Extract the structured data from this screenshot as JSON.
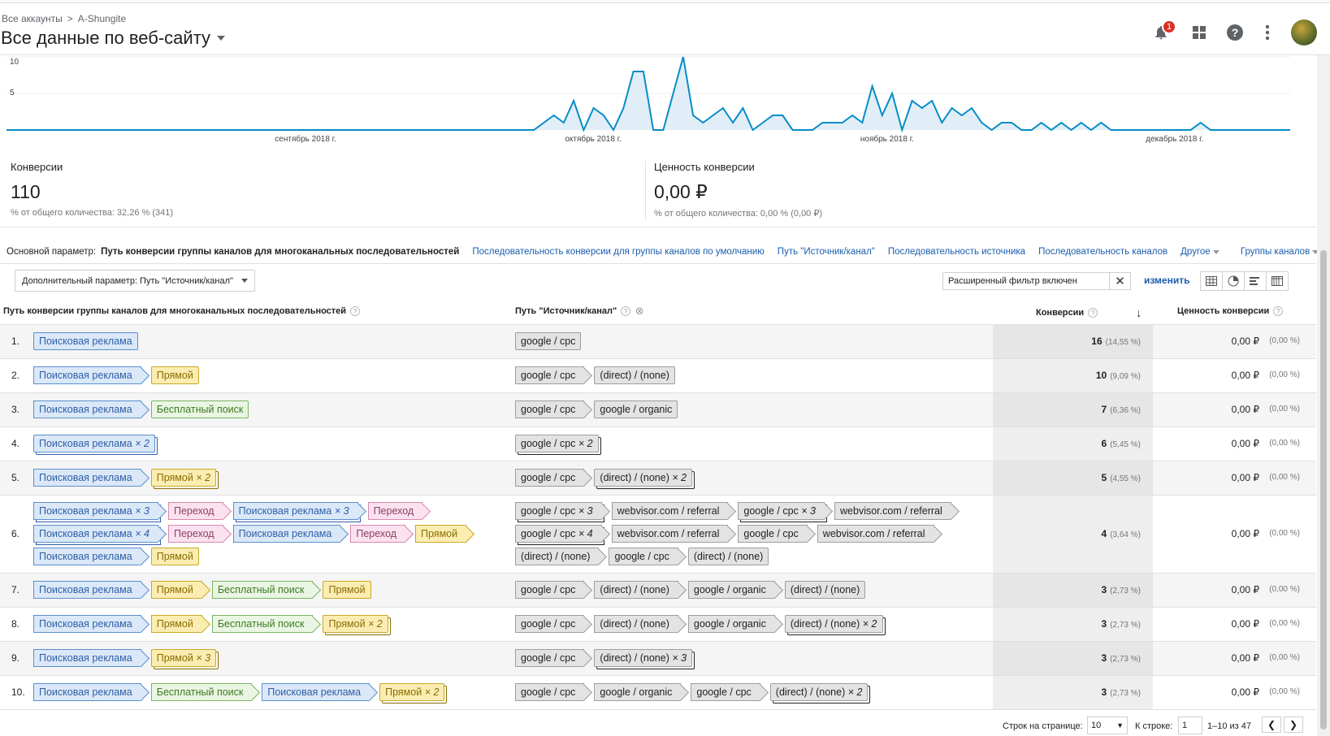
{
  "header": {
    "breadcrumb": [
      "Все аккаунты",
      ">",
      "A-Shungite"
    ],
    "view_title": "Все данные по веб-сайту",
    "notification_count": "1"
  },
  "chart_data": {
    "type": "area",
    "y_ticks": [
      "10",
      "5"
    ],
    "ylim": [
      0,
      10
    ],
    "x_labels": [
      "сентябрь 2018 г.",
      "октябрь 2018 г.",
      "ноябрь 2018 г.",
      "декабрь 2018 г."
    ],
    "values": [
      0,
      0,
      0,
      0,
      0,
      0,
      0,
      0,
      0,
      0,
      0,
      0,
      0,
      0,
      0,
      0,
      0,
      0,
      0,
      0,
      0,
      0,
      0,
      0,
      0,
      0,
      0,
      0,
      0,
      0,
      0,
      0,
      0,
      0,
      0,
      0,
      0,
      0,
      0,
      0,
      0,
      0,
      0,
      0,
      0,
      0,
      0,
      0,
      0,
      0,
      0,
      0,
      0,
      0,
      1,
      2,
      1,
      4,
      0,
      3,
      2,
      0,
      3,
      8,
      8,
      0,
      0,
      5,
      10,
      2,
      1,
      2,
      3,
      1,
      3,
      0,
      1,
      2,
      2,
      0,
      0,
      0,
      1,
      1,
      1,
      2,
      1,
      6,
      2,
      5,
      0,
      4,
      3,
      4,
      1,
      3,
      2,
      3,
      1,
      0,
      1,
      1,
      0,
      0,
      1,
      0,
      1,
      0,
      1,
      0,
      1,
      0,
      0,
      0,
      0,
      0,
      0,
      0,
      0,
      0,
      1,
      0,
      0,
      0,
      0,
      0,
      0,
      0,
      0,
      0
    ],
    "colors": {
      "line": "#058dc7",
      "fill": "#e1eef7"
    }
  },
  "metrics": [
    {
      "label": "Конверсии",
      "value": "110",
      "sub": "% от общего количества: 32,26 % (341)"
    },
    {
      "label": "Ценность конверсии",
      "value": "0,00 ₽",
      "sub": "% от общего количества: 0,00 % (0,00 ₽)"
    }
  ],
  "dimensions": {
    "label": "Основной параметр:",
    "active": "Путь конверсии группы каналов для многоканальных последовательностей",
    "links": [
      "Последовательность конверсии для группы каналов по умолчанию",
      "Путь \"Источник/канал\"",
      "Последовательность источника",
      "Последовательность каналов",
      "Другое",
      "Группы каналов"
    ]
  },
  "controls": {
    "secondary_dimension": "Дополнительный параметр: Путь \"Источник/канал\"",
    "filter_text": "Расширенный фильтр включен",
    "change_label": "изменить"
  },
  "table": {
    "headers": {
      "path": "Путь конверсии группы каналов для многоканальных последовательностей",
      "source": "Путь \"Источник/канал\"",
      "conversions": "Конверсии",
      "value": "Ценность конверсии"
    },
    "rows": [
      {
        "n": "1.",
        "conv": "16",
        "pct": "(14,55 %)",
        "val": "0,00 ₽",
        "vpct": "(0,00 %)"
      },
      {
        "n": "2.",
        "conv": "10",
        "pct": "(9,09 %)",
        "val": "0,00 ₽",
        "vpct": "(0,00 %)"
      },
      {
        "n": "3.",
        "conv": "7",
        "pct": "(6,36 %)",
        "val": "0,00 ₽",
        "vpct": "(0,00 %)"
      },
      {
        "n": "4.",
        "conv": "6",
        "pct": "(5,45 %)",
        "val": "0,00 ₽",
        "vpct": "(0,00 %)"
      },
      {
        "n": "5.",
        "conv": "5",
        "pct": "(4,55 %)",
        "val": "0,00 ₽",
        "vpct": "(0,00 %)"
      },
      {
        "n": "6.",
        "conv": "4",
        "pct": "(3,64 %)",
        "val": "0,00 ₽",
        "vpct": "(0,00 %)"
      },
      {
        "n": "7.",
        "conv": "3",
        "pct": "(2,73 %)",
        "val": "0,00 ₽",
        "vpct": "(0,00 %)"
      },
      {
        "n": "8.",
        "conv": "3",
        "pct": "(2,73 %)",
        "val": "0,00 ₽",
        "vpct": "(0,00 %)"
      },
      {
        "n": "9.",
        "conv": "3",
        "pct": "(2,73 %)",
        "val": "0,00 ₽",
        "vpct": "(0,00 %)"
      },
      {
        "n": "10.",
        "conv": "3",
        "pct": "(2,73 %)",
        "val": "0,00 ₽",
        "vpct": "(0,00 %)"
      }
    ],
    "chip": {
      "search": "Поисковая реклама",
      "direct": "Прямой",
      "organic": "Бесплатный поиск",
      "referral": "Переход",
      "g_cpc": "google / cpc",
      "g_org": "google / organic",
      "direct_none": "(direct) / (none)",
      "webvisor": "webvisor.com / referral",
      "x2": "× 2",
      "x3": "× 3",
      "x4": "× 4"
    }
  },
  "pager": {
    "rows_label": "Строк на странице:",
    "rows_value": "10",
    "goto_label": "К строке:",
    "goto_value": "1",
    "range": "1–10 из 47"
  }
}
